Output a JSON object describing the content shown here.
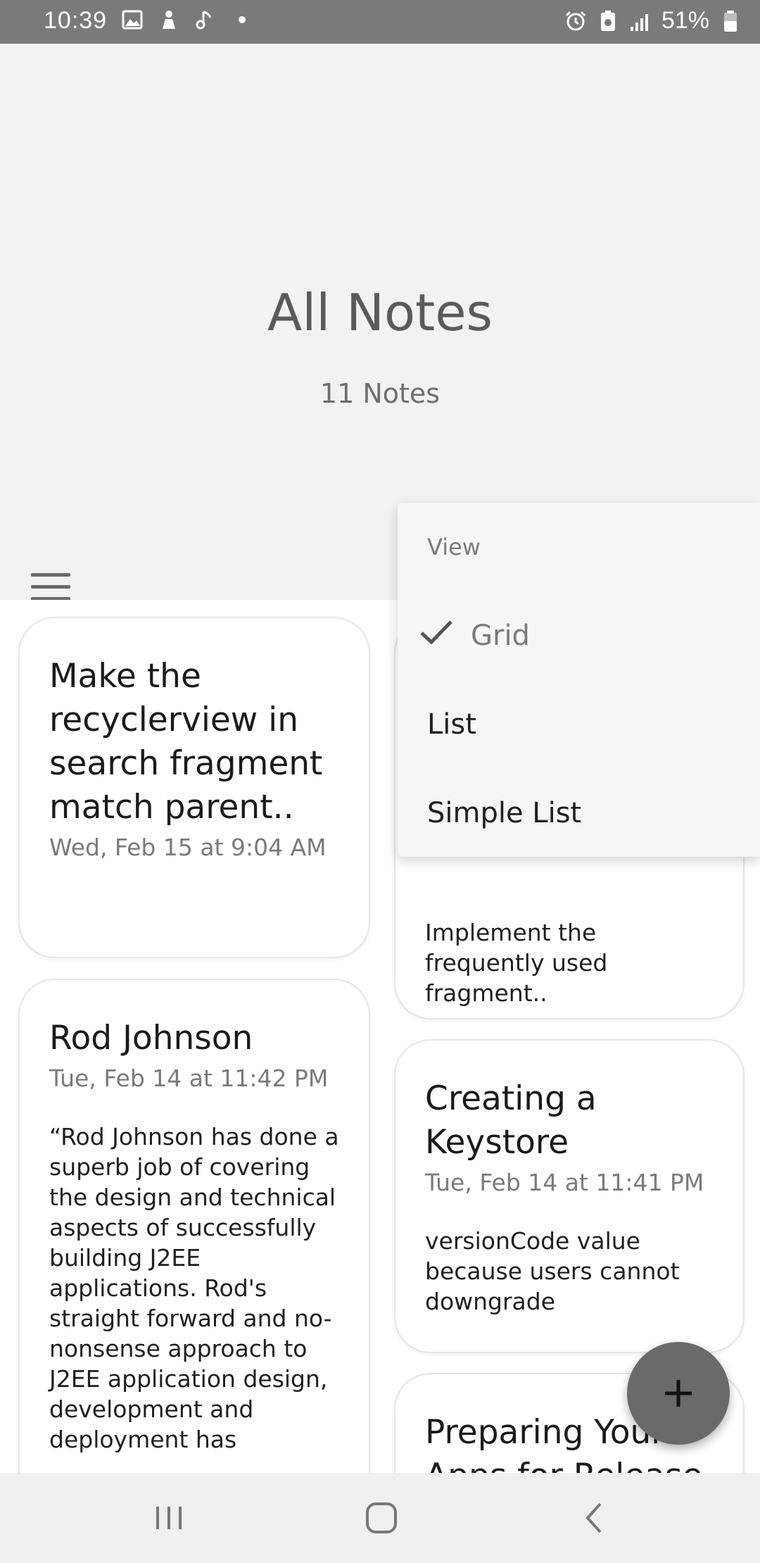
{
  "status_bar": {
    "time": "10:39",
    "battery": "51%",
    "icons_left": [
      "image-icon",
      "figure-icon",
      "music-note-icon",
      "dot-icon"
    ],
    "icons_right": [
      "alarm-icon",
      "battery-saver-icon",
      "signal-icon",
      "battery-icon"
    ]
  },
  "header": {
    "title": "All Notes",
    "count": "11 Notes"
  },
  "notes": [
    {
      "title": "Make the recyclerview in search fragment match parent..",
      "date": "Wed, Feb 15 at 9:04 AM",
      "body": ""
    },
    {
      "title": "",
      "date": "",
      "body": "Implement the frequently used fragment.."
    },
    {
      "title": "Rod Johnson",
      "date": "Tue, Feb 14 at 11:42 PM",
      "body": "“Rod Johnson has done a superb job of covering the design and technical aspects of successfully building J2EE applications. Rod's straight forward and no-nonsense approach to J2EE application design, development and deployment has"
    },
    {
      "title": "Creating a Keystore",
      "date": "Tue, Feb 14 at 11:41 PM",
      "body": "versionCode value because users cannot downgrade"
    },
    {
      "title": "Preparing Your Apps for Release",
      "date": "",
      "body": ""
    }
  ],
  "view_menu": {
    "heading": "View",
    "items": [
      {
        "label": "Grid",
        "checked": true
      },
      {
        "label": "List",
        "checked": false
      },
      {
        "label": "Simple List",
        "checked": false
      }
    ]
  },
  "fab": {
    "icon": "plus-icon"
  },
  "colors": {
    "status_bar": "#7a7a7a",
    "background": "#f2f2f2",
    "fab": "#6a6a6a"
  }
}
